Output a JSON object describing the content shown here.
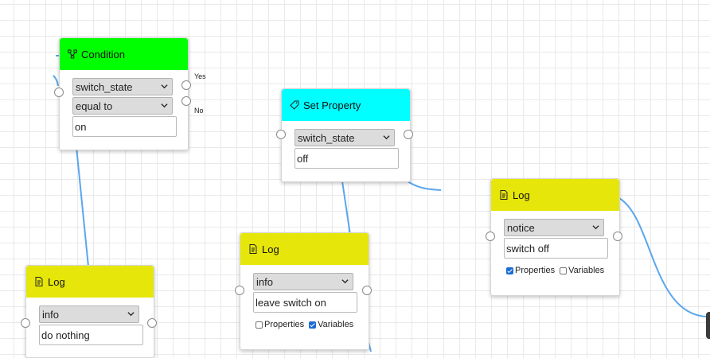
{
  "colors": {
    "condition_header": "#00ff00",
    "set_property_header": "#00ffff",
    "log_header": "#e6e60a",
    "wire": "#5aa6ee",
    "canvas_grid": "#e9e9e9"
  },
  "nodes": {
    "condition": {
      "title": "Condition",
      "icon": "flow-branch-icon",
      "property": "switch_state",
      "operator": "equal to",
      "value": "on",
      "yes_label": "Yes",
      "no_label": "No"
    },
    "set_property": {
      "title": "Set Property",
      "icon": "tag-icon",
      "property": "switch_state",
      "value": "off"
    },
    "log_nothing": {
      "title": "Log",
      "icon": "document-icon",
      "level": "info",
      "message": "do nothing"
    },
    "log_leave": {
      "title": "Log",
      "icon": "document-icon",
      "level": "info",
      "message": "leave switch on",
      "properties_label": "Properties",
      "properties_checked": false,
      "variables_label": "Variables",
      "variables_checked": true
    },
    "log_off": {
      "title": "Log",
      "icon": "document-icon",
      "level": "notice",
      "message": "switch off",
      "properties_label": "Properties",
      "properties_checked": true,
      "variables_label": "Variables",
      "variables_checked": false
    }
  }
}
